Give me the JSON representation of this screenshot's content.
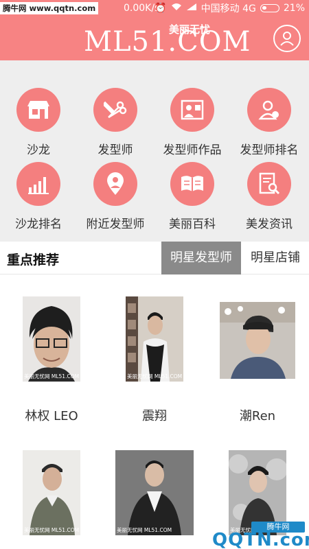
{
  "status_bar": {
    "watermark": "腾牛网 www.qqtn.com",
    "speed": "0.00K/s",
    "carrier": "中国移动 4G",
    "battery": "21%"
  },
  "header": {
    "logo_text": "ML51.COM",
    "logo_sub": "美丽无忧"
  },
  "menu": {
    "items": [
      {
        "label": "沙龙",
        "icon": "salon-shop-icon"
      },
      {
        "label": "发型师",
        "icon": "scissors-comb-icon"
      },
      {
        "label": "发型师作品",
        "icon": "stylist-works-icon"
      },
      {
        "label": "发型师排名",
        "icon": "stylist-rank-icon"
      },
      {
        "label": "沙龙排名",
        "icon": "bar-chart-icon"
      },
      {
        "label": "附近发型师",
        "icon": "location-pin-icon"
      },
      {
        "label": "美丽百科",
        "icon": "open-book-icon"
      },
      {
        "label": "美发资讯",
        "icon": "news-search-icon"
      }
    ]
  },
  "recommend": {
    "title": "重点推荐",
    "tabs": [
      "明星发型师",
      "明星店铺"
    ],
    "active_tab": "明星发型师",
    "stylists": [
      {
        "name": "林权 LEO",
        "watermark": "美丽无忧网 ML51.COM"
      },
      {
        "name": "震翔",
        "watermark": "美丽无忧网 ML51.COM"
      },
      {
        "name": "潮Ren",
        "watermark": ""
      },
      {
        "name": "",
        "watermark": "美丽无忧网 ML51.COM"
      },
      {
        "name": "",
        "watermark": "美丽无忧网 ML51.COM"
      },
      {
        "name": "",
        "watermark": "美丽无忧网 ML51.COM"
      }
    ]
  },
  "bottom_watermark": {
    "badge": "腾牛网",
    "text": "QQTN.com"
  }
}
